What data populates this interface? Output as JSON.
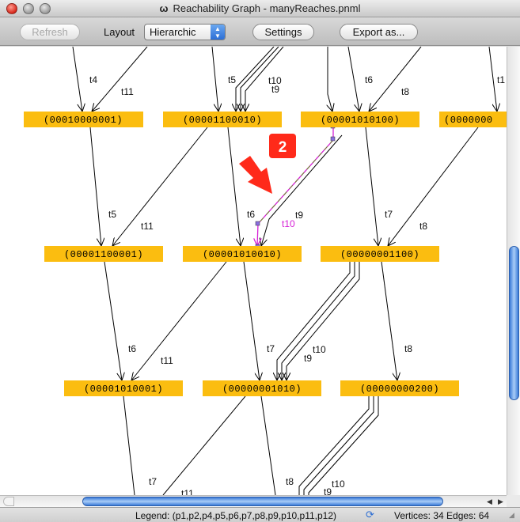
{
  "window": {
    "title": "Reachability Graph - manyReaches.pnml",
    "app_icon": "ω"
  },
  "toolbar": {
    "refresh_label": "Refresh",
    "layout_label": "Layout",
    "layout_value": "Hierarchic",
    "settings_label": "Settings",
    "export_label": "Export as..."
  },
  "graph": {
    "nodes": [
      "(00010000001)",
      "(00001100010)",
      "(00001010100)",
      "(0000000",
      "(00001100001)",
      "(00001010010)",
      "(00000001100)",
      "(00001010001)",
      "(00000001010)",
      "(00000000200)"
    ],
    "edge_labels": {
      "row1": [
        "t4",
        "t11",
        "t5",
        "t10",
        "t9",
        "t6",
        "t8",
        "t1"
      ],
      "row2": [
        "t5",
        "t11",
        "t6",
        "t9",
        "t10",
        "t7",
        "t8"
      ],
      "row3": [
        "t6",
        "t11",
        "t7",
        "t10",
        "t9",
        "t8"
      ],
      "row4": [
        "t7",
        "t11",
        "t8",
        "t10",
        "t9"
      ]
    },
    "callout_number": "2"
  },
  "status": {
    "legend": "Legend: (p1,p2,p4,p5,p6,p7,p8,p9,p10,p11,p12)",
    "stats": "Vertices: 34 Edges: 64"
  },
  "colors": {
    "node_fill": "#fbbd10",
    "selected_edge": "#d61fd6",
    "callout": "#ff2a1a"
  }
}
